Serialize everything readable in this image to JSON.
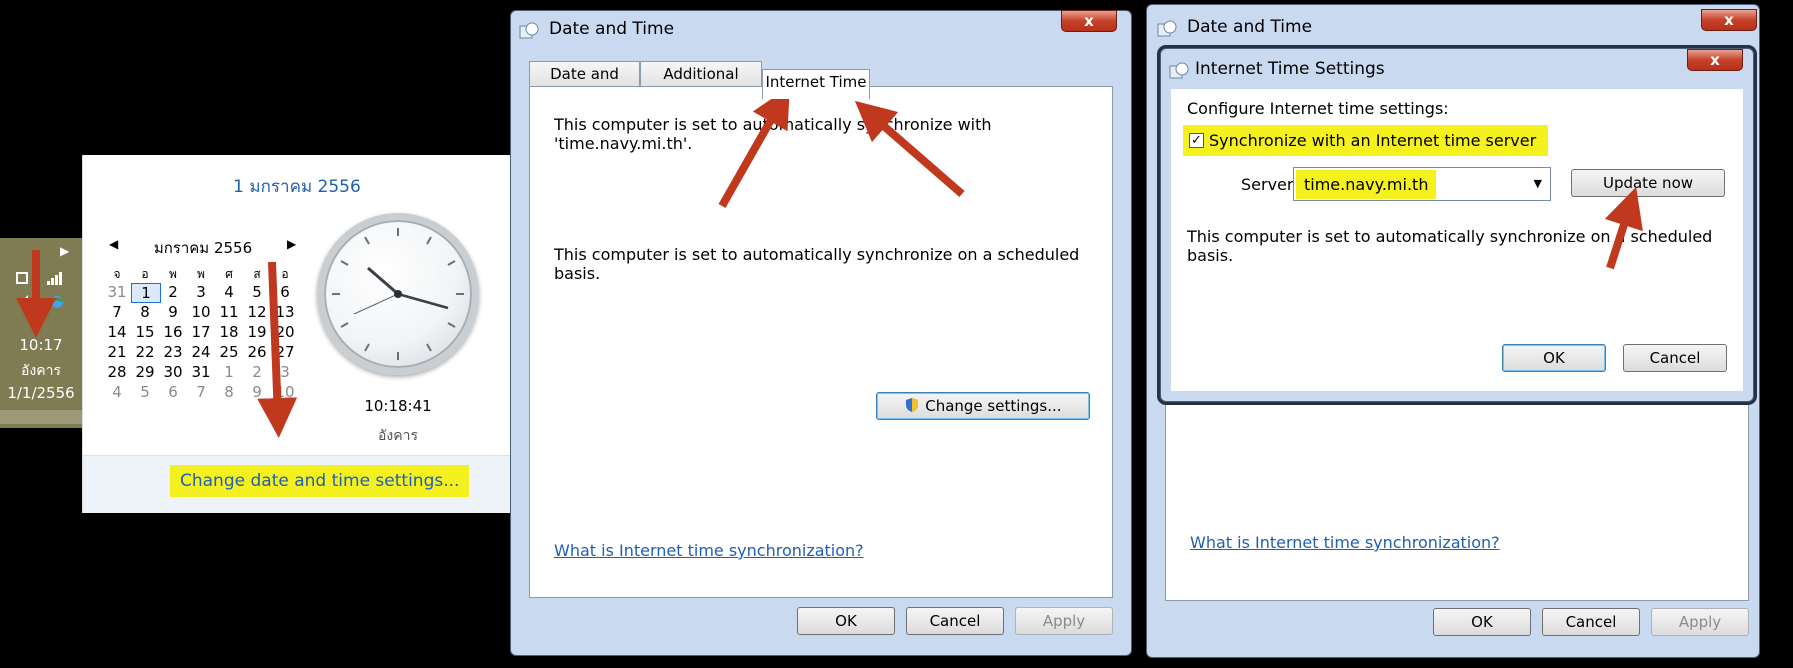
{
  "taskbar": {
    "time": "10:17",
    "weekday": "อังคาร",
    "date": "1/1/2556"
  },
  "calendar_popup": {
    "full_date": "1 มกราคม 2556",
    "month_label": "มกราคม 2556",
    "weekday_headers": [
      "จ",
      "อ",
      "พ",
      "พ",
      "ศ",
      "ส",
      "อ"
    ],
    "weeks": [
      [
        "31",
        "1",
        "2",
        "3",
        "4",
        "5",
        "6"
      ],
      [
        "7",
        "8",
        "9",
        "10",
        "11",
        "12",
        "13"
      ],
      [
        "14",
        "15",
        "16",
        "17",
        "18",
        "19",
        "20"
      ],
      [
        "21",
        "22",
        "23",
        "24",
        "25",
        "26",
        "27"
      ],
      [
        "28",
        "29",
        "30",
        "31",
        "1",
        "2",
        "3"
      ],
      [
        "4",
        "5",
        "6",
        "7",
        "8",
        "9",
        "10"
      ]
    ],
    "clock_time": "10:18:41",
    "clock_weekday": "อังคาร",
    "change_link": "Change date and time settings..."
  },
  "date_time_dialog": {
    "title": "Date and Time",
    "close": "x",
    "tabs": [
      "Date and Time",
      "Additional Clocks",
      "Internet Time"
    ],
    "sync_text": "This computer is set to automatically synchronize with 'time.navy.mi.th'.",
    "schedule_text": "This computer is set to automatically synchronize on a scheduled basis.",
    "change_settings": "Change settings...",
    "help_link": "What is Internet time synchronization?",
    "ok": "OK",
    "cancel": "Cancel",
    "apply": "Apply"
  },
  "back_dialog": {
    "title": "Date and Time",
    "close": "x",
    "help_link": "What is Internet time synchronization?",
    "ok": "OK",
    "cancel": "Cancel",
    "apply": "Apply"
  },
  "internet_time_settings": {
    "title": "Internet Time Settings",
    "close": "x",
    "heading": "Configure Internet time settings:",
    "sync_checkbox_label": "Synchronize with an Internet time server",
    "sync_checked": true,
    "server_label": "Server:",
    "server_value": "time.navy.mi.th",
    "update_now": "Update now",
    "schedule_text": "This computer is set to automatically synchronize on a scheduled basis.",
    "ok": "OK",
    "cancel": "Cancel"
  },
  "colors": {
    "highlight": "#f4f11e",
    "annotation_arrow": "#c0391f",
    "link": "#1f5fb3"
  }
}
